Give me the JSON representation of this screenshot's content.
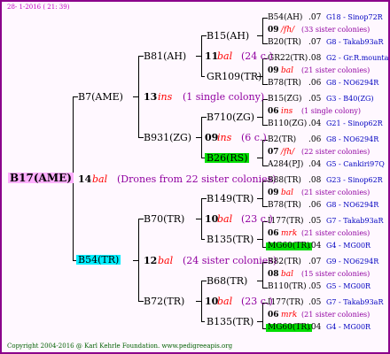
{
  "header": {
    "date": "28- 1-2016 ( 21: 39)"
  },
  "footer": {
    "copyright": "Copyright 2004-2016 @ Karl Kehrle Foundation.   www.pedigreeapis.org"
  },
  "root": {
    "name": "B17(AME)",
    "num": "14",
    "mark": "bal",
    "note": "(Drones from 22 sister colonies)"
  },
  "g1": [
    {
      "name": "B7(AME)",
      "num": "13",
      "mark": "ins",
      "note": "(1 single colony)"
    },
    {
      "name": "B54(TR)",
      "num": "12",
      "mark": "bal",
      "note": "(24 sister colonies)"
    }
  ],
  "g2": [
    {
      "name": "B81(AH)",
      "num": "11",
      "mark": "bal",
      "note": "(24 c.)"
    },
    {
      "name": "B931(ZG)",
      "num": "09",
      "mark": "ins",
      "note": "(6 c.)"
    },
    {
      "name": "B70(TR)",
      "num": "10",
      "mark": "bal",
      "note": "(23 c.)"
    },
    {
      "name": "B72(TR)",
      "num": "10",
      "mark": "bal",
      "note": "(23 c.)"
    }
  ],
  "g3": [
    {
      "name": "B15(AH)"
    },
    {
      "name": "GR109(TR)"
    },
    {
      "name": "B710(ZG)"
    },
    {
      "name": "B26(RS)"
    },
    {
      "name": "B149(TR)"
    },
    {
      "name": "B135(TR)"
    },
    {
      "name": "B68(TR)"
    },
    {
      "name": "B135(TR)"
    }
  ],
  "g4": [
    {
      "top": {
        "name": "B54(AH)",
        "yr": ".07",
        "breeder": "G18 - Sinop72R"
      },
      "mid": {
        "num": "09",
        "mark": "/fh/",
        "note": "(33 sister colonies)"
      },
      "bot": {
        "name": "B20(TR)",
        "yr": ".07",
        "breeder": "G8 - Takab93aR"
      }
    },
    {
      "top": {
        "name": "GR22(TR)",
        "yr": ".08",
        "breeder": "G2 - Gr.R.mounta"
      },
      "mid": {
        "num": "09",
        "mark": "bal",
        "note": "(21 sister colonies)"
      },
      "bot": {
        "name": "B78(TR)",
        "yr": ".06",
        "breeder": "G8 - NO6294R"
      }
    },
    {
      "top": {
        "name": "B15(ZG)",
        "yr": ".05",
        "breeder": "G3 - B40(ZG)"
      },
      "mid": {
        "num": "06",
        "mark": "ins",
        "note": "(1 single colony)"
      },
      "bot": {
        "name": "B110(ZG)",
        "yr": ".04",
        "breeder": "G21 - Sinop62R"
      }
    },
    {
      "top": {
        "name": "B2(TR)",
        "yr": ".06",
        "breeder": "G8 - NO6294R"
      },
      "mid": {
        "num": "07",
        "mark": "/fh/",
        "note": "(22 sister colonies)"
      },
      "bot": {
        "name": "A284(PJ)",
        "yr": ".04",
        "breeder": "G5 - Cankiri97Q"
      }
    },
    {
      "top": {
        "name": "B88(TR)",
        "yr": ".08",
        "breeder": "G23 - Sinop62R"
      },
      "mid": {
        "num": "09",
        "mark": "bal",
        "note": "(21 sister colonies)"
      },
      "bot": {
        "name": "B78(TR)",
        "yr": ".06",
        "breeder": "G8 - NO6294R"
      }
    },
    {
      "top": {
        "name": "I177(TR)",
        "yr": ".05",
        "breeder": "G7 - Takab93aR"
      },
      "mid": {
        "num": "06",
        "mark": "mrk",
        "note": "(21 sister colonies)"
      },
      "bot": {
        "name": "MG60(TR)",
        "yr": ".04",
        "breeder": "G4 - MG00R"
      }
    },
    {
      "top": {
        "name": "B82(TR)",
        "yr": ".07",
        "breeder": "G9 - NO6294R"
      },
      "mid": {
        "num": "08",
        "mark": "bal",
        "note": "(15 sister colonies)"
      },
      "bot": {
        "name": "B110(TR)",
        "yr": ".05",
        "breeder": "G5 - MG00R"
      }
    },
    {
      "top": {
        "name": "I177(TR)",
        "yr": ".05",
        "breeder": "G7 - Takab93aR"
      },
      "mid": {
        "num": "06",
        "mark": "mrk",
        "note": "(21 sister colonies)"
      },
      "bot": {
        "name": "MG60(TR)",
        "yr": ".04",
        "breeder": "G4 - MG00R"
      }
    }
  ]
}
